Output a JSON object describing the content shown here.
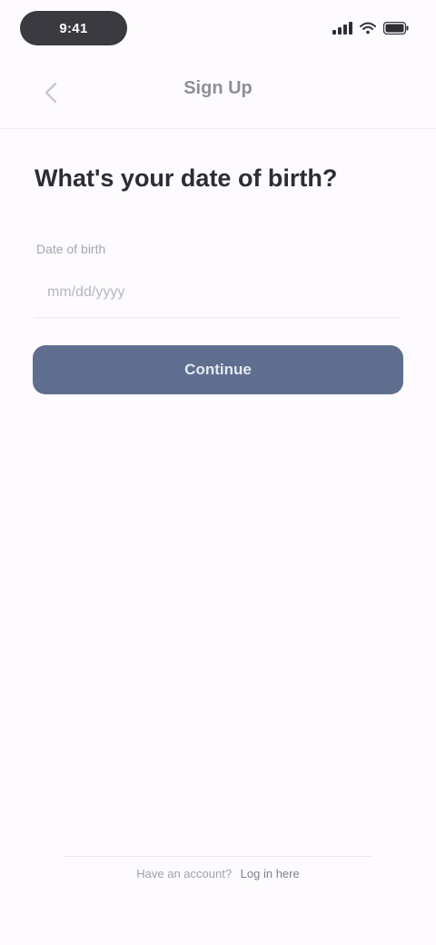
{
  "status_bar": {
    "time": "9:41"
  },
  "header": {
    "title": "Sign Up"
  },
  "main": {
    "question": "What's your date of birth?",
    "field_label": "Date of birth",
    "date_placeholder": "mm/dd/yyyy",
    "continue_label": "Continue"
  },
  "footer": {
    "text": "Have an account?",
    "link": "Log in here"
  },
  "colors": {
    "background": "#fdfbfe",
    "primary_button": "#5f6e8f",
    "text_dark": "#2d2d35",
    "text_muted": "#a6a6ae"
  }
}
